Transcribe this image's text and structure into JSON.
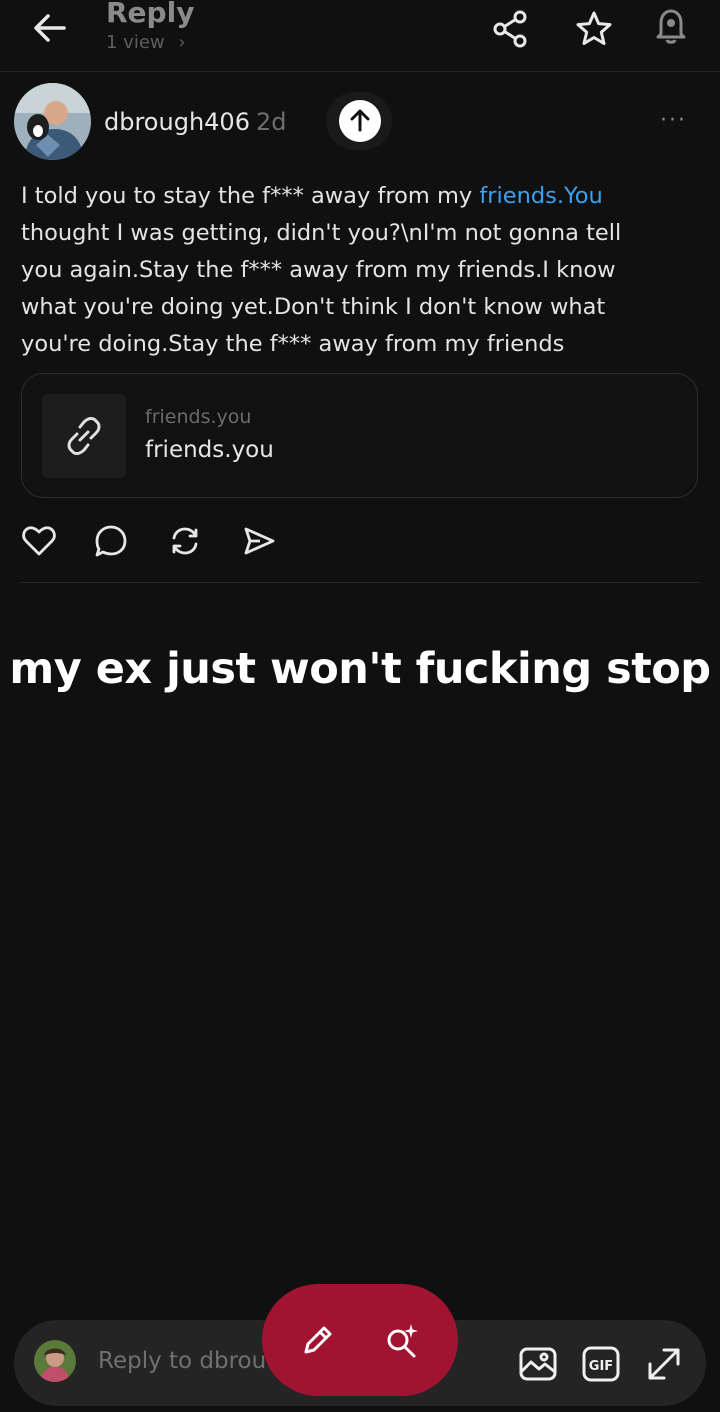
{
  "header": {
    "title": "Reply",
    "views": "1 view",
    "views_chevron": "›"
  },
  "post": {
    "username": "dbrough406",
    "age": "2d",
    "more": "···",
    "lines": [
      {
        "before": "I told you to stay the f*** away from my ",
        "link": "friends.You",
        "after": ""
      },
      {
        "before": "thought I was getting, didn't you?\\nI'm not gonna tell",
        "link": "",
        "after": ""
      },
      {
        "before": "you again.Stay the f*** away from my friends.I know",
        "link": "",
        "after": ""
      },
      {
        "before": "what you're doing yet.Don't think I don't know what",
        "link": "",
        "after": ""
      },
      {
        "before": "you're doing.Stay the f*** away from my friends",
        "link": "",
        "after": ""
      }
    ],
    "link_card": {
      "domain": "friends.you",
      "title": "friends.you"
    }
  },
  "overlay_caption": "my ex just won't fucking stop",
  "reply_bar": {
    "placeholder": "Reply to dbrou"
  },
  "colors": {
    "background": "#101010",
    "link": "#3aa0f0",
    "fab": "#a01432"
  },
  "icons": [
    "back-arrow-icon",
    "share-icon",
    "star-icon",
    "notification-bell-icon",
    "scroll-up-icon",
    "link-icon",
    "heart-icon",
    "comment-icon",
    "repost-icon",
    "send-icon",
    "pencil-icon",
    "sparkle-search-icon",
    "image-icon",
    "gif-icon",
    "expand-icon"
  ]
}
